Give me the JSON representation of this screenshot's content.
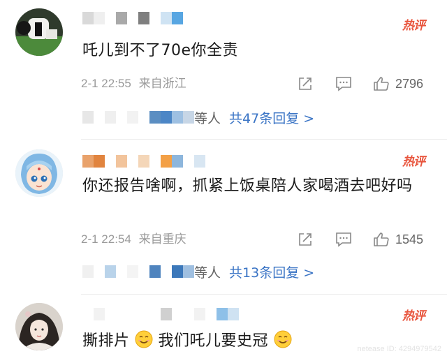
{
  "hot_label": "热评",
  "comments": [
    {
      "text": "吒儿到不了70e你全责",
      "time": "2-1 22:55",
      "location": "来自浙江",
      "likes": "2796",
      "replies_suffix": "等人",
      "replies_link": "共47条回复 >"
    },
    {
      "text": "你还报告啥啊，抓紧上饭桌陪人家喝酒去吧好吗",
      "time": "2-1 22:54",
      "location": "来自重庆",
      "likes": "1545",
      "replies_suffix": "等人",
      "replies_link": "共13条回复 >"
    },
    {
      "text_a": "撕排片",
      "text_b": "我们吒儿要史冠"
    }
  ],
  "icons": [
    "share-icon",
    "comment-icon",
    "like-icon",
    "smile-emoji-icon"
  ],
  "colors": {
    "hot": "#e8543c",
    "link": "#3a74c5",
    "meta": "#9a9a9a"
  },
  "watermark": "netease ID: 4294979542"
}
